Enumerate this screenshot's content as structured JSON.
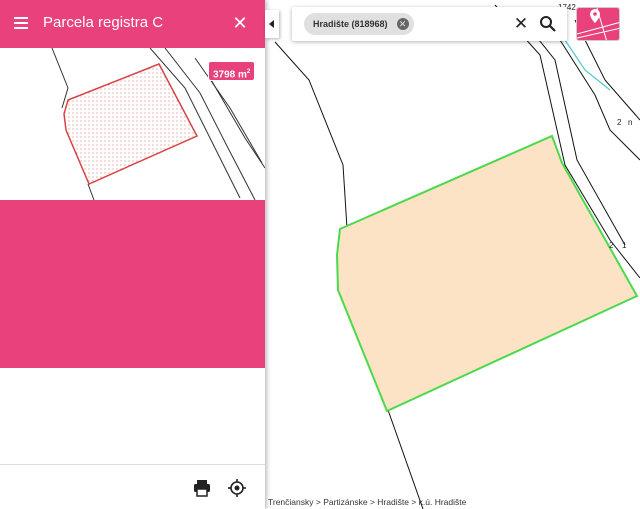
{
  "panel": {
    "title": "Parcela registra C",
    "area_value": "3798 m",
    "area_unit_sup": "2"
  },
  "search": {
    "chip_label": "Hradište (818968)"
  },
  "map": {
    "labels": [
      "1742",
      "2",
      "n",
      "2",
      "1"
    ]
  },
  "breadcrumb": "Trenčiansky > Partizánske > Hradište > k.ú. Hradište",
  "colors": {
    "accent": "#e8417b",
    "parcel_fill": "#fde3c5",
    "parcel_outline": "#4cd94c",
    "preview_outline": "#d64545"
  },
  "icons": {
    "menu": "menu-icon",
    "close": "close-icon",
    "print": "print-icon",
    "locate": "gps-locate-icon",
    "search": "search-icon",
    "clear": "close-icon",
    "layers": "map-layer-icon"
  }
}
